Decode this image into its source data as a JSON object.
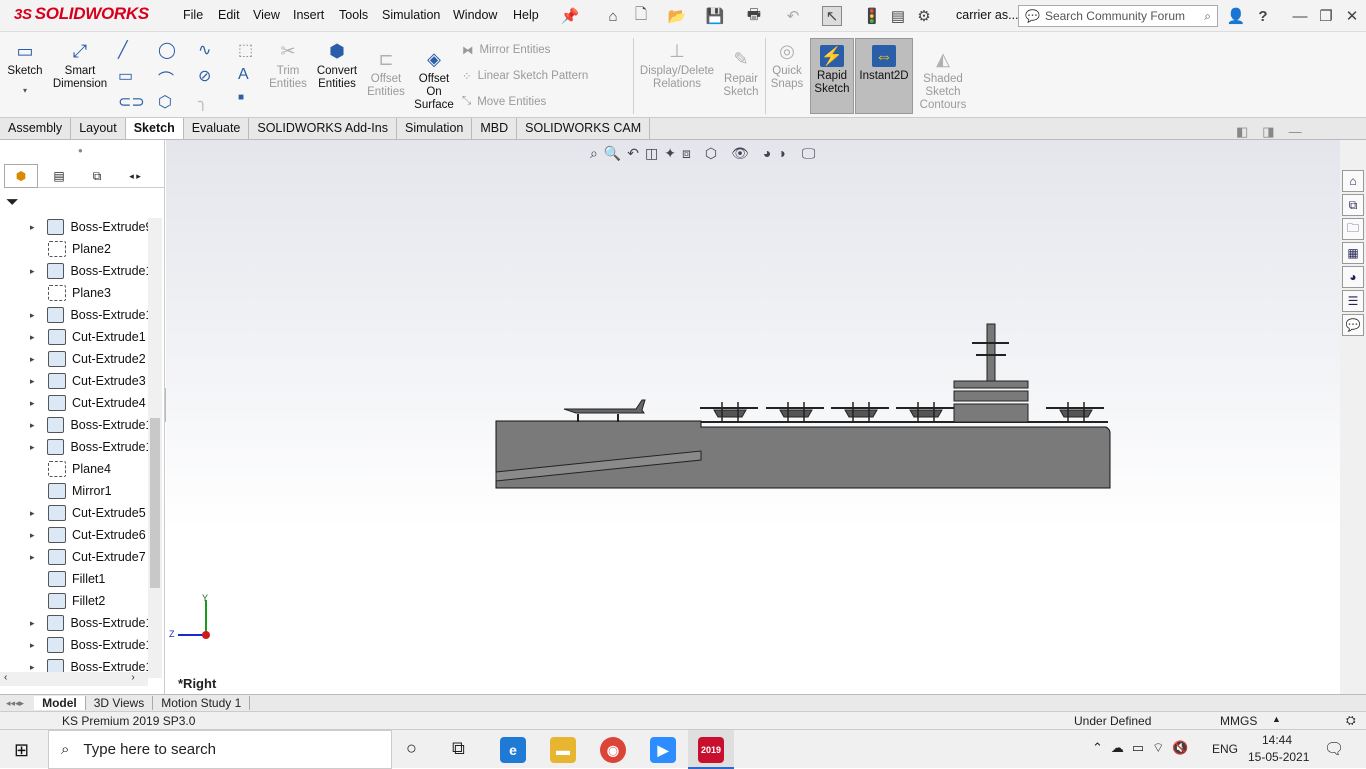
{
  "app": {
    "logo_text": "SOLIDWORKS",
    "logo_ds": "3S",
    "menu": [
      "File",
      "Edit",
      "View",
      "Insert",
      "Tools",
      "Simulation",
      "Window",
      "Help"
    ],
    "doc_title": "carrier as...",
    "search_placeholder": "Search Community Forum"
  },
  "ribbon": {
    "sketch": "Sketch",
    "smart_dimension": [
      "Smart",
      "Dimension"
    ],
    "trim": [
      "Trim",
      "Entities"
    ],
    "convert": [
      "Convert",
      "Entities"
    ],
    "offset_entities": [
      "Offset",
      "Entities"
    ],
    "offset_surface": [
      "Offset",
      "On",
      "Surface"
    ],
    "mirror": "Mirror Entities",
    "linear_pattern": "Linear Sketch Pattern",
    "move": "Move Entities",
    "display_relations": [
      "Display/Delete",
      "Relations"
    ],
    "repair": [
      "Repair",
      "Sketch"
    ],
    "quick_snaps": [
      "Quick",
      "Snaps"
    ],
    "rapid_sketch": [
      "Rapid",
      "Sketch"
    ],
    "instant2d": "Instant2D",
    "shaded_contours": [
      "Shaded",
      "Sketch",
      "Contours"
    ]
  },
  "command_tabs": [
    {
      "label": "Assembly"
    },
    {
      "label": "Layout"
    },
    {
      "label": "Sketch",
      "selected": true
    },
    {
      "label": "Evaluate"
    },
    {
      "label": "SOLIDWORKS Add-Ins"
    },
    {
      "label": "Simulation"
    },
    {
      "label": "MBD"
    },
    {
      "label": "SOLIDWORKS CAM"
    }
  ],
  "tree": [
    {
      "label": "Boss-Extrude9",
      "expand": true,
      "type": "body"
    },
    {
      "label": "Plane2",
      "expand": false,
      "type": "plane"
    },
    {
      "label": "Boss-Extrude1",
      "expand": true,
      "type": "body"
    },
    {
      "label": "Plane3",
      "expand": false,
      "type": "plane"
    },
    {
      "label": "Boss-Extrude1",
      "expand": true,
      "type": "body"
    },
    {
      "label": "Cut-Extrude1",
      "expand": true,
      "type": "cut"
    },
    {
      "label": "Cut-Extrude2",
      "expand": true,
      "type": "cut"
    },
    {
      "label": "Cut-Extrude3",
      "expand": true,
      "type": "cut"
    },
    {
      "label": "Cut-Extrude4",
      "expand": true,
      "type": "cut"
    },
    {
      "label": "Boss-Extrude1",
      "expand": true,
      "type": "body"
    },
    {
      "label": "Boss-Extrude1",
      "expand": true,
      "type": "body"
    },
    {
      "label": "Plane4",
      "expand": false,
      "type": "plane"
    },
    {
      "label": "Mirror1",
      "expand": false,
      "type": "cut"
    },
    {
      "label": "Cut-Extrude5",
      "expand": true,
      "type": "cut"
    },
    {
      "label": "Cut-Extrude6",
      "expand": true,
      "type": "cut"
    },
    {
      "label": "Cut-Extrude7",
      "expand": true,
      "type": "cut"
    },
    {
      "label": "Fillet1",
      "expand": false,
      "type": "fillet"
    },
    {
      "label": "Fillet2",
      "expand": false,
      "type": "fillet"
    },
    {
      "label": "Boss-Extrude1",
      "expand": true,
      "type": "body"
    },
    {
      "label": "Boss-Extrude1",
      "expand": true,
      "type": "body"
    },
    {
      "label": "Boss-Extrude1",
      "expand": true,
      "type": "body"
    }
  ],
  "viewport": {
    "view_label": "*Right",
    "axis_y": "Y",
    "axis_z": "Z"
  },
  "bottom_tabs": [
    {
      "label": "Model",
      "selected": true
    },
    {
      "label": "3D Views"
    },
    {
      "label": "Motion Study 1"
    }
  ],
  "status": {
    "version": "KS Premium 2019 SP3.0",
    "state": "Under Defined",
    "units": "MMGS"
  },
  "taskbar": {
    "search_placeholder": "Type here to search",
    "sw_badge": "2019",
    "language": "ENG",
    "time": "14:44",
    "date": "15-05-2021"
  },
  "colors": {
    "hull": "#7a7a7a",
    "accent": "#d6001c",
    "selected_ribbon": "#bdbdbd"
  }
}
